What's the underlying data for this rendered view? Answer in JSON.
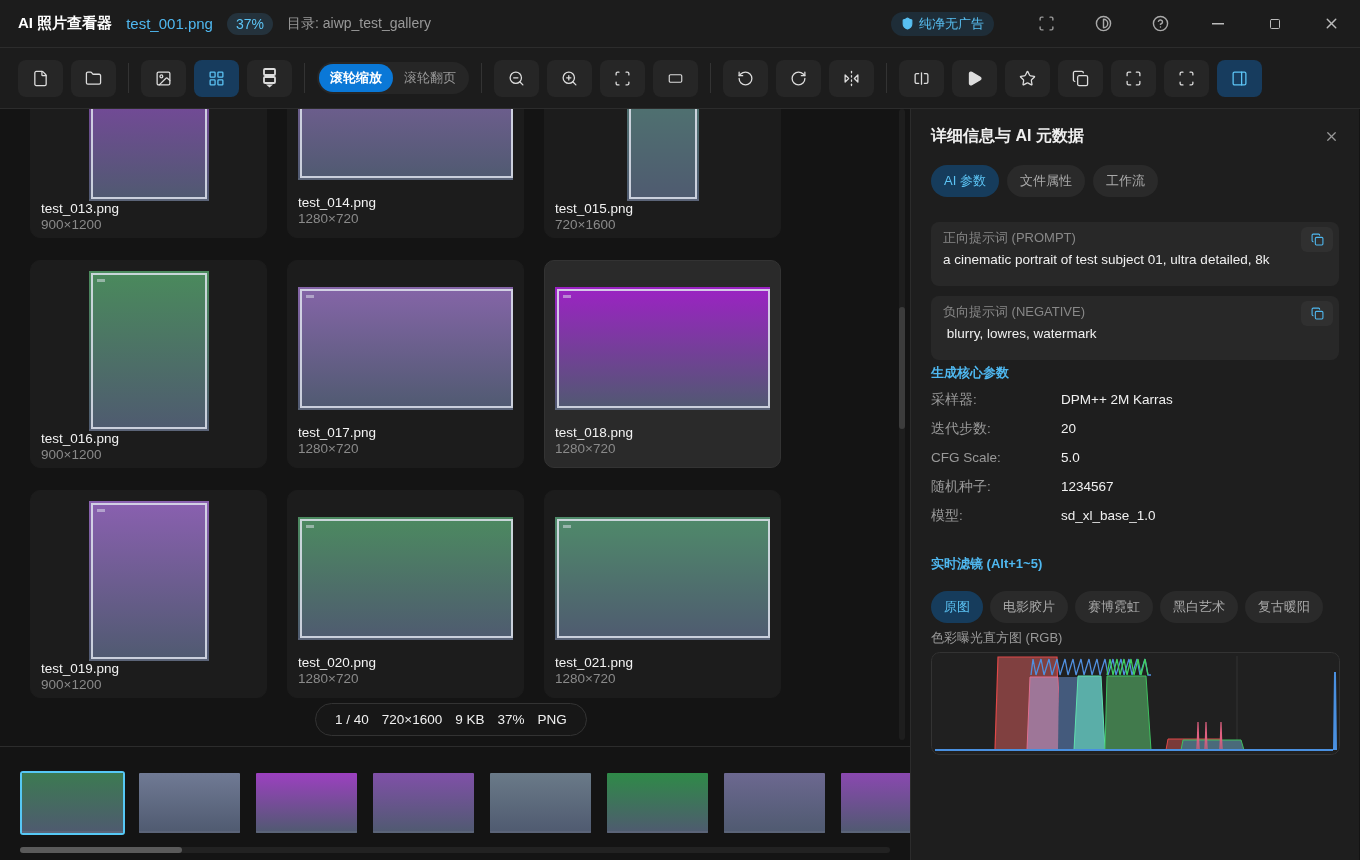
{
  "title_bar": {
    "app_name": "AI 照片查看器",
    "file_name": "test_001.png",
    "zoom": "37%",
    "directory": "目录: aiwp_test_gallery",
    "badge": "纯净无广告",
    "buttons": [
      {
        "kind": "fullscreen"
      },
      {
        "kind": "theme"
      },
      {
        "kind": "help"
      },
      {
        "kind": "minimize"
      },
      {
        "kind": "maximize"
      },
      {
        "kind": "close"
      }
    ]
  },
  "toolbar": {
    "groups": [
      {
        "items": [
          {
            "kind": "file",
            "selected": false
          },
          {
            "kind": "folder",
            "selected": false
          }
        ]
      },
      {
        "items": [
          {
            "kind": "single",
            "selected": false
          },
          {
            "kind": "grid",
            "selected": true
          },
          {
            "kind": "strip",
            "selected": false
          }
        ]
      },
      {
        "wheel_modes": [
          {
            "label": "滚轮缩放",
            "selected": true
          },
          {
            "label": "滚轮翻页",
            "selected": false
          }
        ]
      },
      {
        "items": [
          {
            "kind": "zoom-out",
            "selected": false
          },
          {
            "kind": "zoom-in",
            "selected": false
          },
          {
            "kind": "fit",
            "selected": false
          },
          {
            "kind": "actual-size",
            "selected": false
          }
        ]
      },
      {
        "items": [
          {
            "kind": "rotate-left",
            "selected": false
          },
          {
            "kind": "rotate-right",
            "selected": false
          },
          {
            "kind": "flip",
            "selected": false
          }
        ]
      },
      {
        "items": [
          {
            "kind": "compare",
            "selected": false
          },
          {
            "kind": "play",
            "selected": false
          },
          {
            "kind": "star",
            "selected": false
          },
          {
            "kind": "copy",
            "selected": false
          },
          {
            "kind": "expand",
            "selected": false
          },
          {
            "kind": "focus",
            "selected": false
          },
          {
            "kind": "panel",
            "selected": true
          }
        ]
      }
    ]
  },
  "gallery": {
    "cards": [
      {
        "name": "test_013.png",
        "size": "900×1200",
        "selected": false
      },
      {
        "name": "test_014.png",
        "size": "1280×720",
        "selected": false
      },
      {
        "name": "test_015.png",
        "size": "720×1600",
        "selected": false
      },
      {
        "name": "test_016.png",
        "size": "900×1200",
        "selected": false
      },
      {
        "name": "test_017.png",
        "size": "1280×720",
        "selected": false
      },
      {
        "name": "test_018.png",
        "size": "1280×720",
        "selected": true
      },
      {
        "name": "test_019.png",
        "size": "900×1200",
        "selected": false
      },
      {
        "name": "test_020.png",
        "size": "1280×720",
        "selected": false
      },
      {
        "name": "test_021.png",
        "size": "1280×720",
        "selected": false
      }
    ],
    "status": [
      "1 / 40",
      "720×1600",
      "9 KB",
      "37%",
      "PNG"
    ]
  },
  "filmstrip": [
    {
      "selected": true
    },
    {
      "selected": false
    },
    {
      "selected": false
    },
    {
      "selected": false
    },
    {
      "selected": false
    },
    {
      "selected": false
    },
    {
      "selected": false
    },
    {
      "selected": false
    }
  ],
  "panel": {
    "title": "详细信息与 AI 元数据",
    "tabs": [
      {
        "label": "AI 参数",
        "selected": true
      },
      {
        "label": "文件属性",
        "selected": false
      },
      {
        "label": "工作流",
        "selected": false
      }
    ],
    "prompts": [
      {
        "label": "正向提示词 (PROMPT)",
        "text": "a cinematic portrait of test subject 01, ultra detailed, 8k"
      },
      {
        "label": "负向提示词 (NEGATIVE)",
        "text": " blurry, lowres, watermark"
      }
    ],
    "params_title": "生成核心参数",
    "params": [
      {
        "key": "采样器:",
        "value": "DPM++ 2M Karras"
      },
      {
        "key": "迭代步数:",
        "value": "20"
      },
      {
        "key": "CFG Scale:",
        "value": "5.0"
      },
      {
        "key": "随机种子:",
        "value": "1234567"
      },
      {
        "key": "模型:",
        "value": "sd_xl_base_1.0"
      }
    ],
    "filters_title": "实时滤镜 (Alt+1~5)",
    "filters": [
      {
        "label": "原图",
        "selected": true
      },
      {
        "label": "电影胶片",
        "selected": false
      },
      {
        "label": "赛博霓虹",
        "selected": false
      },
      {
        "label": "黑白艺术",
        "selected": false
      },
      {
        "label": "复古暖阳",
        "selected": false
      }
    ],
    "histogram_label": "色彩曝光直方图 (RGB)"
  }
}
